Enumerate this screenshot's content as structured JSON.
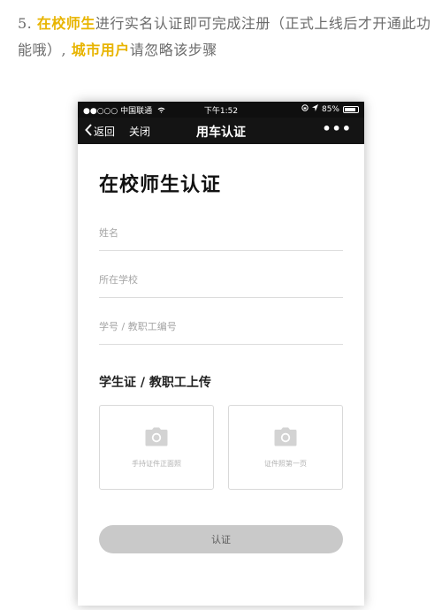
{
  "note": {
    "prefix": "5.",
    "highlight1": "在校师生",
    "text1": "进行实名认证即可完成注册（正式上线后才开通此功能哦）,",
    "highlight2": "城市用户",
    "text2": "请忽略该步骤"
  },
  "status_bar": {
    "carrier": "●●○○○ 中国联通",
    "time": "下午1:52",
    "battery_text": "85%"
  },
  "nav": {
    "back_label": "返回",
    "close_label": "关闭",
    "title": "用车认证",
    "more_label": "•••"
  },
  "page": {
    "title": "在校师生认证"
  },
  "form": {
    "name_placeholder": "姓名",
    "school_placeholder": "所在学校",
    "id_placeholder": "学号 / 教职工编号"
  },
  "upload_section": {
    "title": "学生证 / 教职工上传",
    "box1_label": "手持证件正面照",
    "box2_label": "证件照第一页"
  },
  "submit_label": "认证",
  "colors": {
    "highlight": "#e8b400",
    "nav_bg": "#141414",
    "button_bg": "#c9c9c9"
  }
}
